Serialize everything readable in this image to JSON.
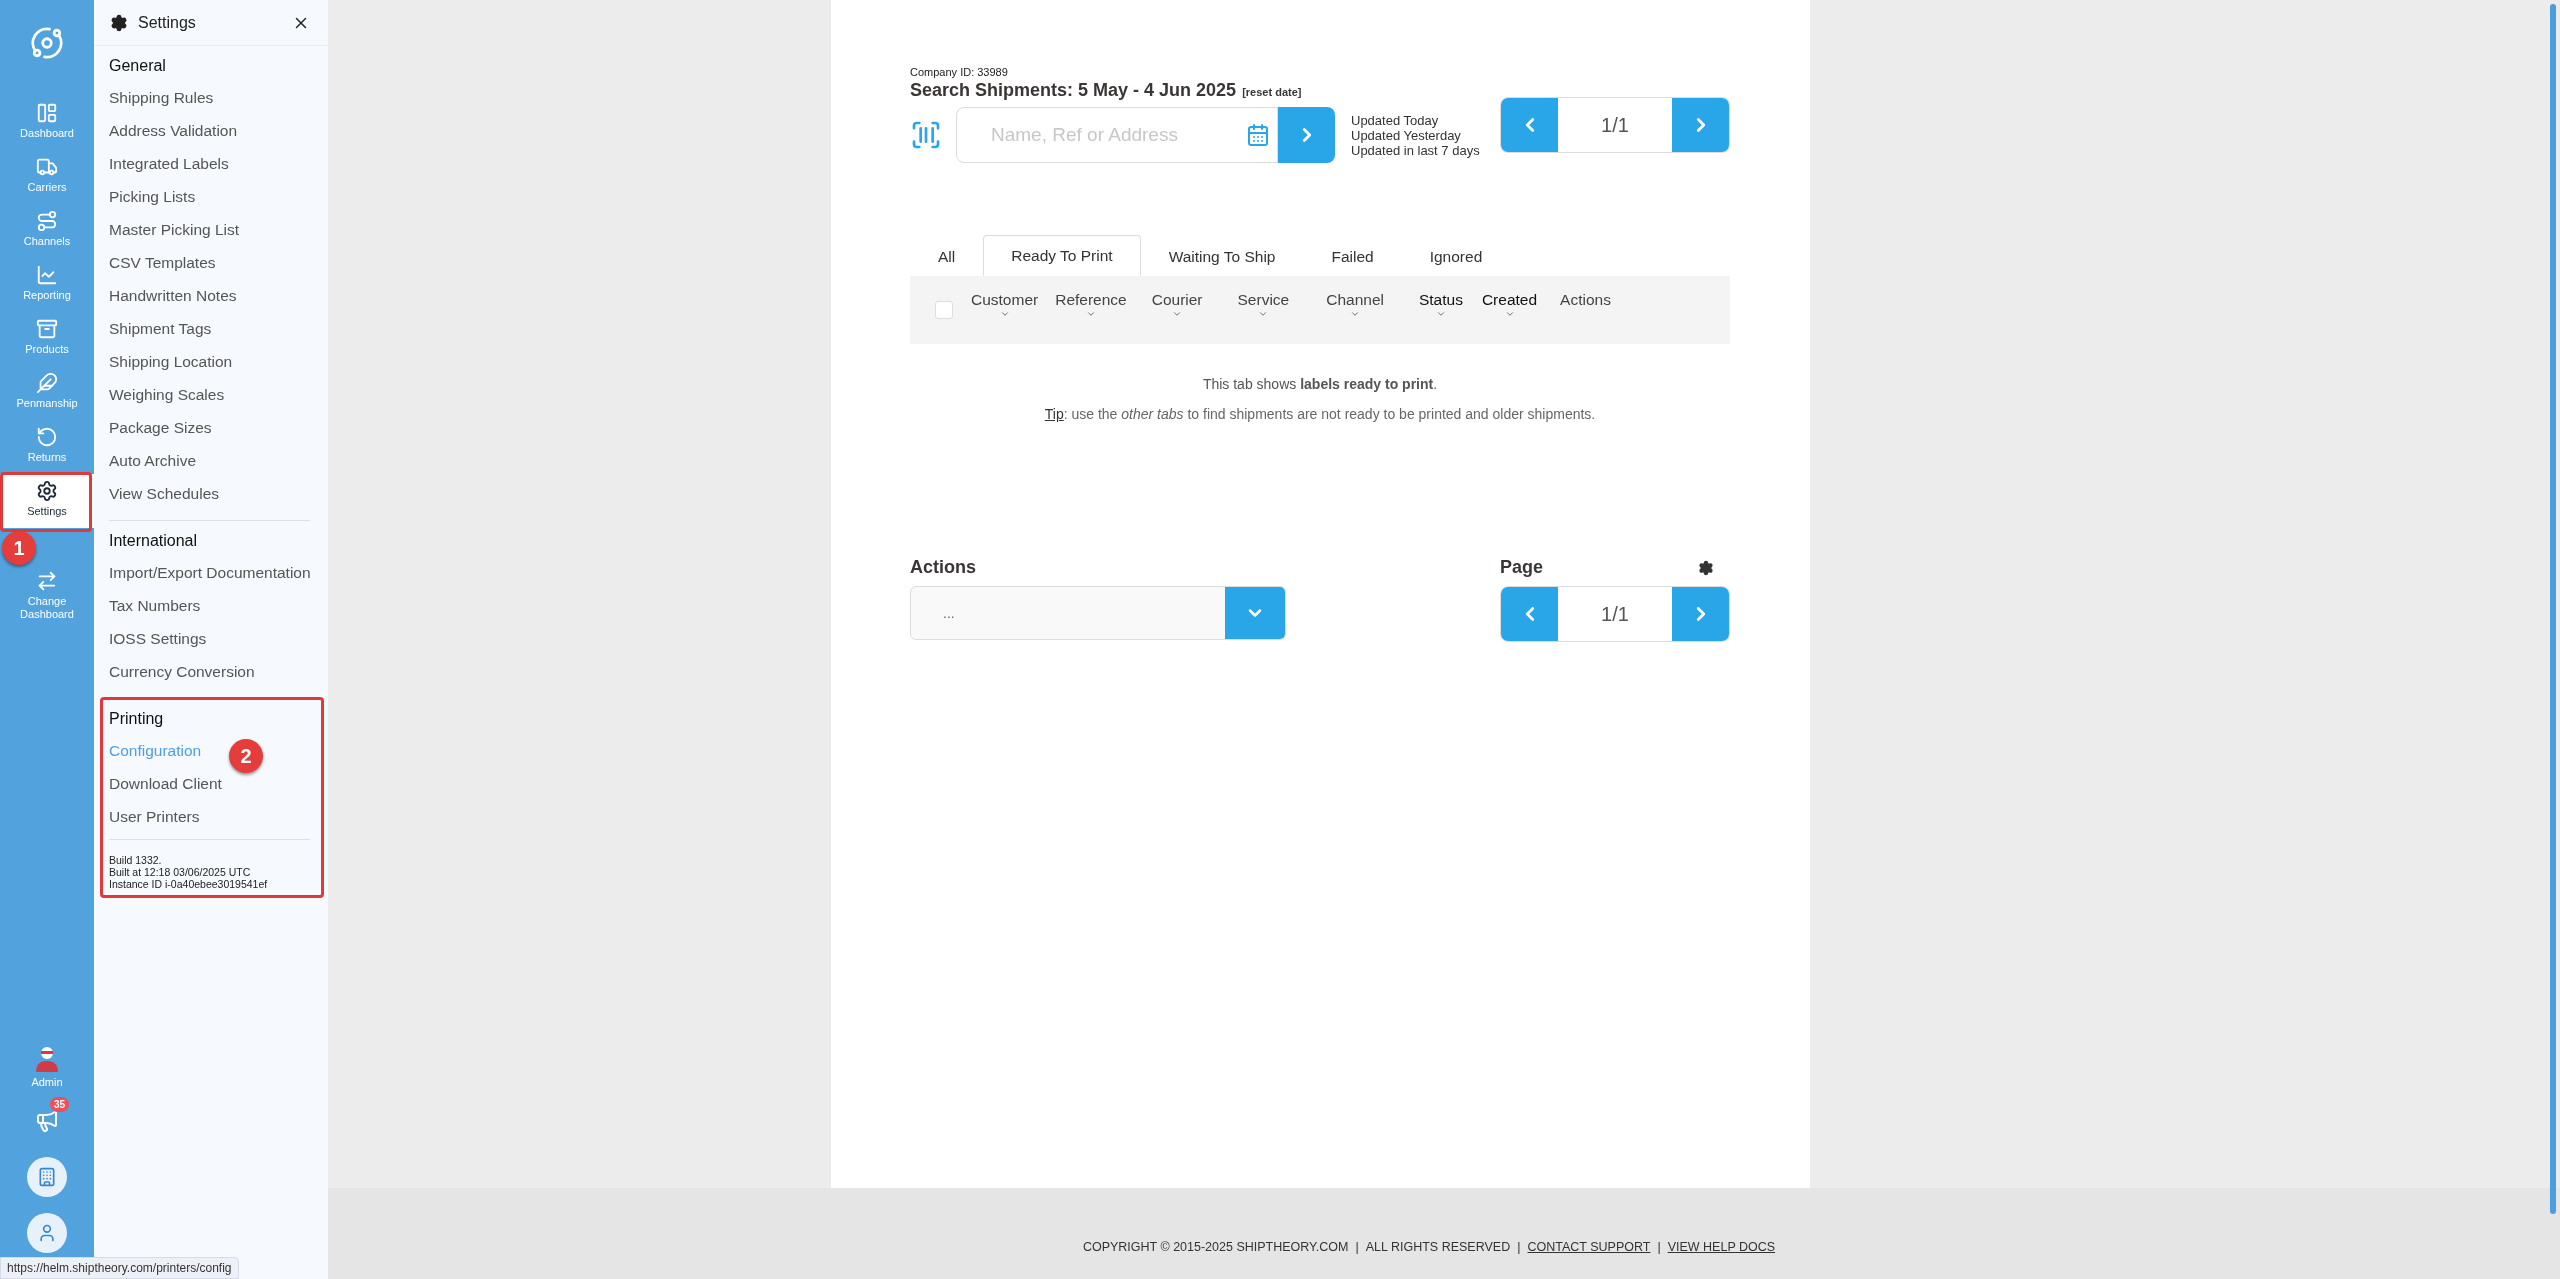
{
  "nav": {
    "items": [
      {
        "label": "Dashboard",
        "selected": false
      },
      {
        "label": "Carriers",
        "selected": false
      },
      {
        "label": "Channels",
        "selected": false
      },
      {
        "label": "Reporting",
        "selected": false
      },
      {
        "label": "Products",
        "selected": false
      },
      {
        "label": "Penmanship",
        "selected": false
      },
      {
        "label": "Returns",
        "selected": false
      },
      {
        "label": "Settings",
        "selected": true,
        "callout": "1"
      },
      {
        "label": "Change Dashboard",
        "selected": false
      }
    ],
    "admin": {
      "label": "Admin"
    },
    "notifications": {
      "badge": "35"
    }
  },
  "settings_panel": {
    "title": "Settings",
    "sections": [
      {
        "heading": "General",
        "items": [
          {
            "label": "Shipping Rules",
            "hovered": false
          },
          {
            "label": "Address Validation",
            "hovered": false
          },
          {
            "label": "Integrated Labels",
            "hovered": false
          },
          {
            "label": "Picking Lists",
            "hovered": false
          },
          {
            "label": "Master Picking List",
            "hovered": false
          },
          {
            "label": "CSV Templates",
            "hovered": false
          },
          {
            "label": "Handwritten Notes",
            "hovered": false
          },
          {
            "label": "Shipment Tags",
            "hovered": false
          },
          {
            "label": "Shipping Location",
            "hovered": false
          },
          {
            "label": "Weighing Scales",
            "hovered": false
          },
          {
            "label": "Package Sizes",
            "hovered": false
          },
          {
            "label": "Auto Archive",
            "hovered": false
          },
          {
            "label": "View Schedules",
            "hovered": false
          }
        ]
      },
      {
        "heading": "International",
        "items": [
          {
            "label": "Import/Export Documentation",
            "hovered": false
          },
          {
            "label": "Tax Numbers",
            "hovered": false
          },
          {
            "label": "IOSS Settings",
            "hovered": false
          },
          {
            "label": "Currency Conversion",
            "hovered": false
          }
        ]
      },
      {
        "heading": "Printing",
        "callout": "2",
        "items": [
          {
            "label": "Configuration",
            "hovered": true
          },
          {
            "label": "Download Client",
            "hovered": false
          },
          {
            "label": "User Printers",
            "hovered": false
          }
        ],
        "build_info": [
          "Build 1332.",
          "Built at 12:18 03/06/2025 UTC",
          "Instance ID i-0a40ebee3019541ef"
        ]
      }
    ]
  },
  "status_url": "https://helm.shiptheory.com/printers/config",
  "search": {
    "company_id": "Company ID: 33989",
    "title": "Search Shipments: 5 May - 4 Jun 2025",
    "reset": "[reset date]",
    "placeholder": "Name, Ref or Address",
    "quick_filters": [
      "Updated Today",
      "Updated Yesterday",
      "Updated in last 7 days"
    ],
    "pager": "1/1"
  },
  "tabs": [
    {
      "label": "All",
      "selected": false
    },
    {
      "label": "Ready To Print",
      "selected": true
    },
    {
      "label": "Waiting To Ship",
      "selected": false
    },
    {
      "label": "Failed",
      "selected": false
    },
    {
      "label": "Ignored",
      "selected": false
    }
  ],
  "table": {
    "select_all_checked": false,
    "columns": [
      {
        "label": "Customer",
        "sortable": true,
        "emphasized": false
      },
      {
        "label": "Reference",
        "sortable": true,
        "emphasized": false
      },
      {
        "label": "Courier",
        "sortable": true,
        "emphasized": false
      },
      {
        "label": "Service",
        "sortable": true,
        "emphasized": false
      },
      {
        "label": "Channel",
        "sortable": true,
        "emphasized": false
      },
      {
        "label": "Status",
        "sortable": true,
        "emphasized": true
      },
      {
        "label": "Created",
        "sortable": true,
        "emphasized": true
      },
      {
        "label": "Actions",
        "sortable": false,
        "emphasized": false
      }
    ]
  },
  "empty_message": "This tab shows **labels ready to print**.",
  "tip": {
    "link": "Tip",
    "text": ": use the *other tabs* to find shipments are not ready to be printed and older shipments."
  },
  "actions": {
    "label": "Actions",
    "value": "..."
  },
  "page": {
    "label": "Page",
    "pager": "1/1"
  },
  "footer": [
    {
      "text": "COPYRIGHT © 2015-2025 SHIPTHEORY.COM",
      "kind": "text"
    },
    {
      "text": "|",
      "kind": "separator"
    },
    {
      "text": "ALL RIGHTS RESERVED",
      "kind": "text"
    },
    {
      "text": "|",
      "kind": "separator"
    },
    {
      "text": "CONTACT SUPPORT",
      "kind": "link"
    },
    {
      "text": "|",
      "kind": "separator"
    },
    {
      "text": "VIEW HELP DOCS",
      "kind": "link"
    }
  ]
}
